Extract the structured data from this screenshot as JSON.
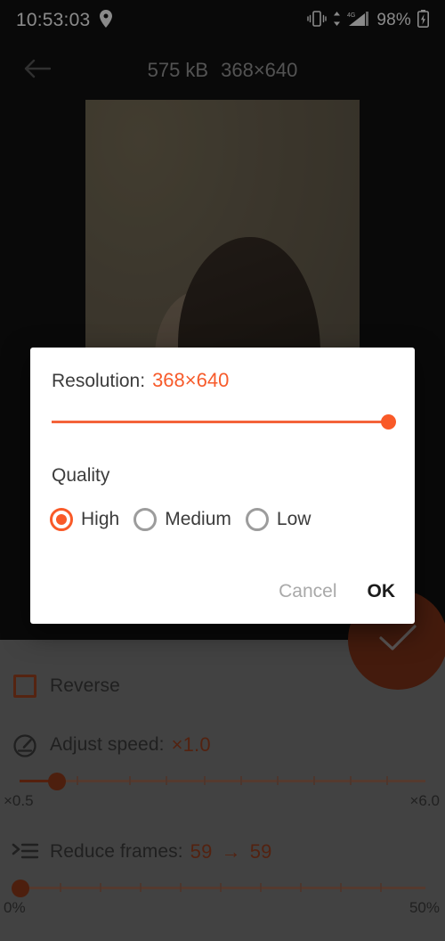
{
  "status_bar": {
    "time": "10:53:03",
    "location_icon": "location-pin-icon",
    "vibrate_icon": "vibrate-icon",
    "network_type": "4G",
    "signal_icon": "signal-bars-icon",
    "battery_percent": "98%",
    "battery_icon": "battery-charging-icon"
  },
  "toolbar": {
    "back_icon": "back-arrow-icon",
    "file_size": "575 kB",
    "dimensions": "368×640"
  },
  "fab": {
    "icon": "check-icon",
    "color": "#7f3318"
  },
  "settings": {
    "reverse": {
      "label": "Reverse",
      "checked": false,
      "checkbox_icon": "checkbox-unchecked-icon"
    },
    "adjust_speed": {
      "icon": "speedometer-icon",
      "label": "Adjust speed:",
      "value": "×1.0",
      "min_label": "×0.5",
      "max_label": "×6.0",
      "thumb_percent": 9
    },
    "reduce_frames": {
      "icon": "reduce-frames-icon",
      "label": "Reduce frames:",
      "value_from": "59",
      "arrow": "→",
      "value_to": "59",
      "min_label": "0%",
      "max_label": "50%",
      "thumb_percent": 0
    }
  },
  "dialog": {
    "resolution_label": "Resolution:",
    "resolution_value": "368×640",
    "resolution_slider_percent": 100,
    "quality_label": "Quality",
    "quality_options": [
      {
        "label": "High",
        "selected": true
      },
      {
        "label": "Medium",
        "selected": false
      },
      {
        "label": "Low",
        "selected": false
      }
    ],
    "cancel_label": "Cancel",
    "ok_label": "OK"
  },
  "colors": {
    "accent": "#f95a28",
    "accent_dim": "#9a3f1f",
    "panel_bg": "#7a7a7a",
    "app_bg": "#111111",
    "dialog_bg": "#ffffff"
  }
}
